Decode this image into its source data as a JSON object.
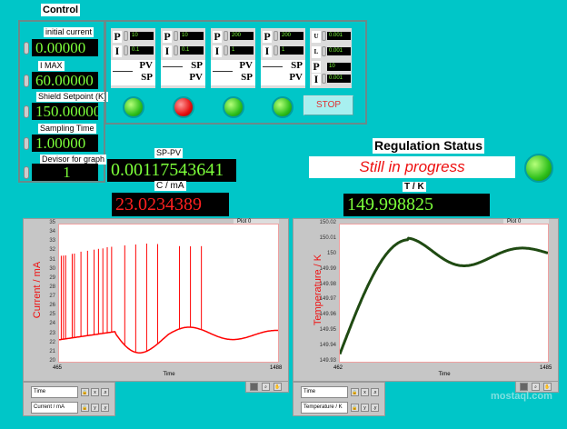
{
  "control": {
    "title": "Control",
    "items": [
      {
        "label": "initial current",
        "value": "0.00000"
      },
      {
        "label": "I MAX",
        "value": "60.00000"
      },
      {
        "label": "Shield Setpoint (K)",
        "value": "150.00000"
      },
      {
        "label": "Sampling Time",
        "value": "1.00000"
      },
      {
        "label": "Devisor for graph",
        "value": "1"
      }
    ]
  },
  "pid": [
    {
      "p_label": "P",
      "p": "10",
      "i_label": "I",
      "i": "0.1",
      "top": "PV",
      "bottom": "SP"
    },
    {
      "p_label": "P",
      "p": "10",
      "i_label": "I",
      "i": "0.1",
      "top": "SP",
      "bottom": "PV"
    },
    {
      "p_label": "P",
      "p": "200",
      "i_label": "I",
      "i": "1",
      "top": "PV",
      "bottom": "SP"
    },
    {
      "p_label": "P",
      "p": "200",
      "i_label": "I",
      "i": "1",
      "top": "SP",
      "bottom": "PV"
    }
  ],
  "limits": {
    "u_label": "U",
    "u": "0.001",
    "l_label": "L",
    "l": "0.001",
    "p_label": "P",
    "p": "10",
    "i_label": "I",
    "i": "0.001"
  },
  "leds": [
    "green",
    "red",
    "green",
    "green"
  ],
  "stop_label": "STOP",
  "sp_pv": {
    "label": "SP-PV",
    "value": "0.00117543641"
  },
  "current": {
    "label": "C / mA",
    "value": "23.0234389"
  },
  "regulation": {
    "label": "Regulation Status",
    "status": "Still in progress",
    "led": "green"
  },
  "temperature": {
    "label": "T / K",
    "value": "149.998825"
  },
  "graphs": [
    {
      "plot_label": "Plot 0",
      "xlabel": "Time",
      "ylabel": "Current / mA",
      "xmin": "465",
      "xmax": "1488",
      "yticks": [
        "35",
        "34",
        "33",
        "32",
        "31",
        "30",
        "29",
        "28",
        "27",
        "26",
        "25",
        "24",
        "23",
        "22",
        "21",
        "20"
      ],
      "legend_x": "Time",
      "legend_y": "Current / mA",
      "color": "#ff0000"
    },
    {
      "plot_label": "Plot 0",
      "xlabel": "Time",
      "ylabel": "Temperature / K",
      "xmin": "462",
      "xmax": "1485",
      "yticks": [
        "150.02",
        "150.01",
        "150",
        "149.99",
        "149.98",
        "149.97",
        "149.96",
        "149.95",
        "149.94",
        "149.93"
      ],
      "legend_x": "Time",
      "legend_y": "Temperature / K",
      "color": "#1f4a12"
    }
  ],
  "watermark": "mostaql.com"
}
